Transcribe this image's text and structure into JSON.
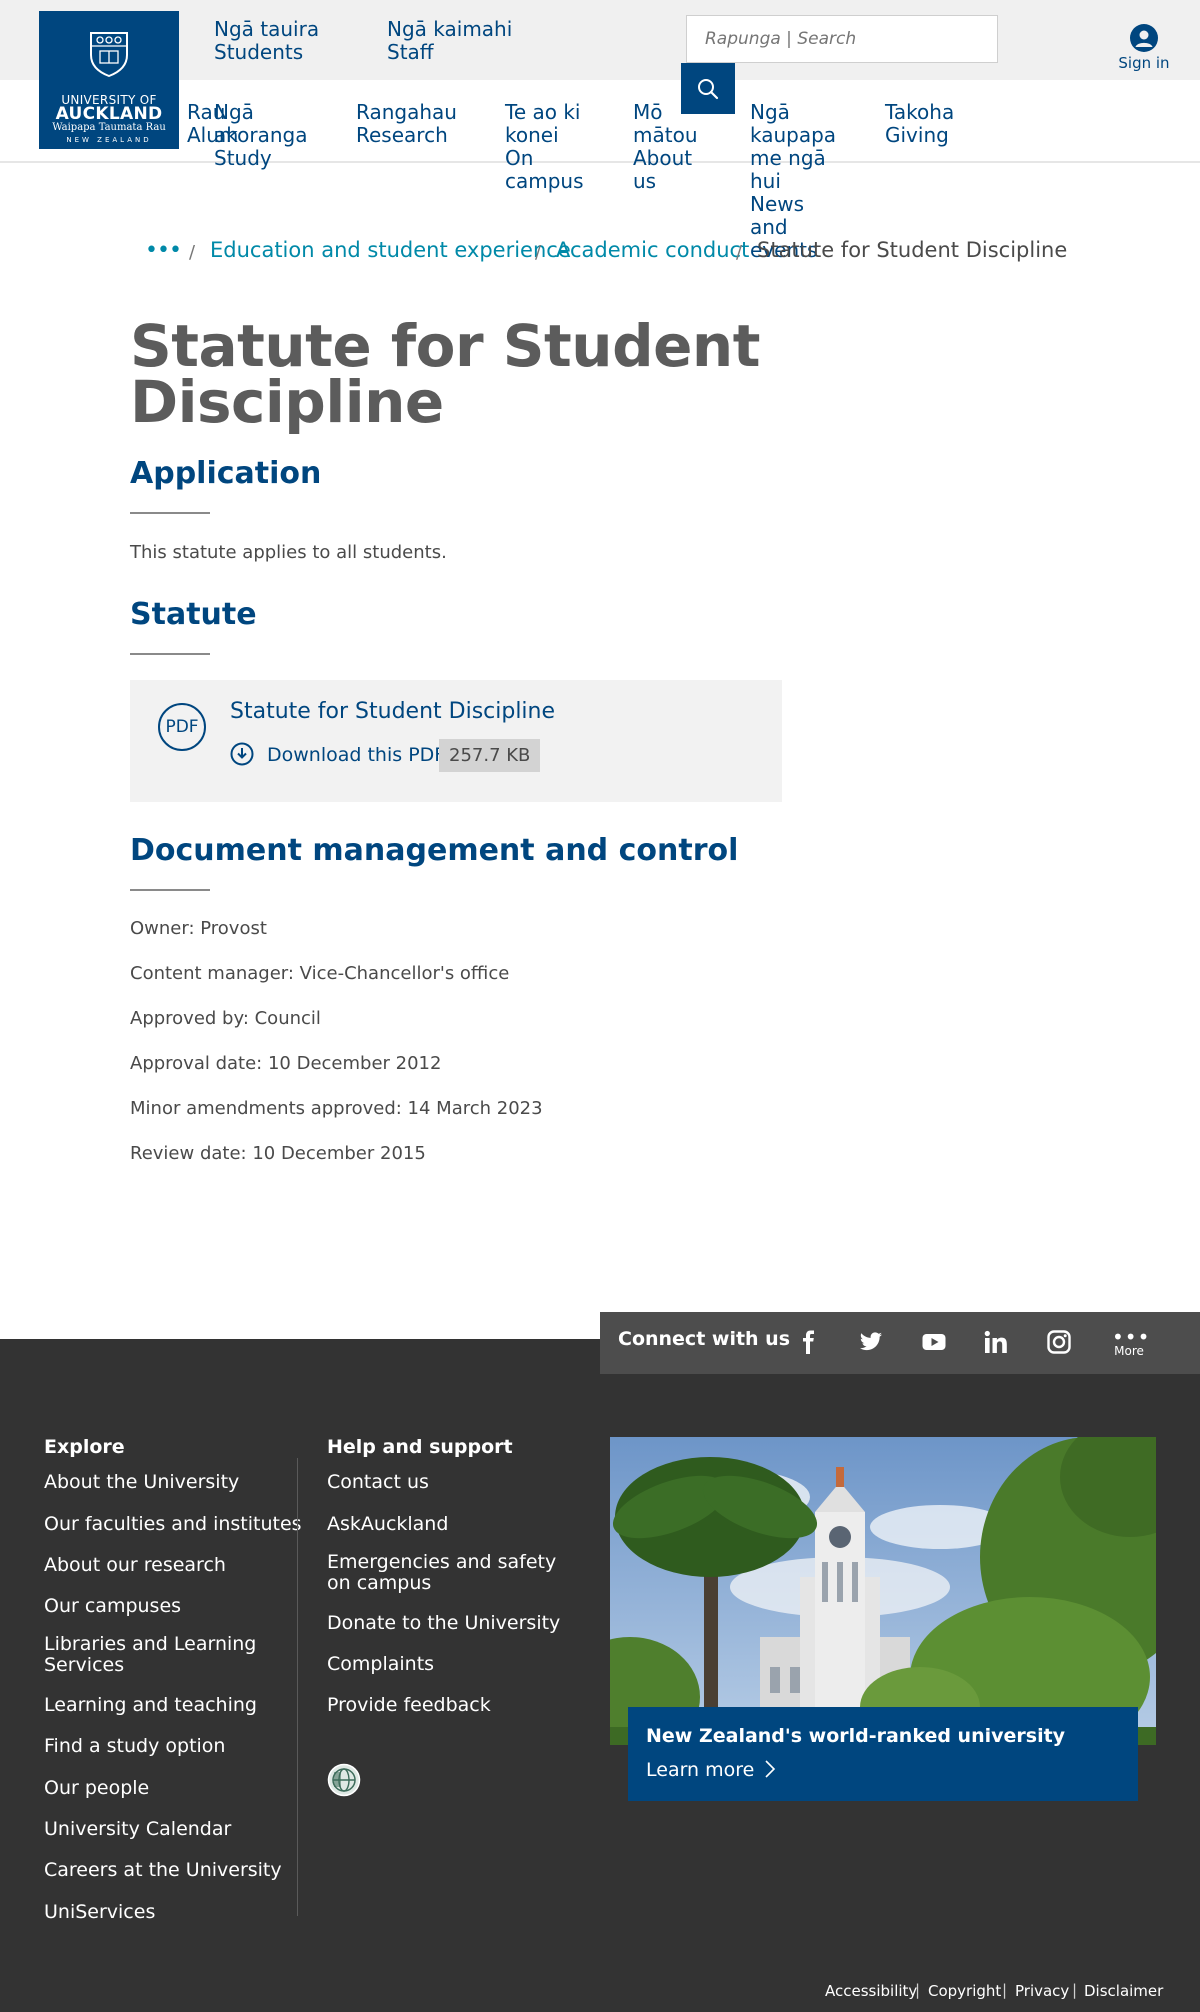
{
  "header": {
    "logo": {
      "line1": "UNIVERSITY OF",
      "line2": "AUCKLAND",
      "line3": "Waipapa Taumata Rau",
      "line4": "NEW ZEALAND"
    },
    "top_links": [
      {
        "maori": "Ngā tauira",
        "english": "Students"
      },
      {
        "maori": "Ngā kaimahi",
        "english": "Staff"
      }
    ],
    "search_placeholder": "Rapunga | Search",
    "sign_in": "Sign in",
    "nav": [
      {
        "line1": "Rau",
        "line1b": "Alum",
        "overlap1": "Ngā",
        "overlap2": "ni"
      },
      {
        "maori1": "akoranga",
        "english": "Study"
      },
      {
        "maori": "Rangahau",
        "english": "Research"
      },
      {
        "lines": [
          "Te ao ki",
          "konei",
          "On",
          "campus"
        ]
      },
      {
        "lines": [
          "Mō",
          "mātou",
          "About",
          "us"
        ]
      },
      {
        "lines": [
          "Ngā",
          "kaupapa",
          "me ngā",
          "hui",
          "News",
          "and",
          "events"
        ]
      },
      {
        "maori": "Takoha",
        "english": "Giving"
      }
    ]
  },
  "breadcrumb": {
    "ellipsis": "•••",
    "sep": "/",
    "items": [
      "Education and student experience",
      "Academic conduct"
    ],
    "current": "Statute for Student Discipline"
  },
  "page": {
    "title": "Statute for Student Discipline",
    "sections": {
      "application": {
        "heading": "Application",
        "text": "This statute applies to all students."
      },
      "statute": {
        "heading": "Statute",
        "pdf_badge": "PDF",
        "pdf_title": "Statute for Student Discipline",
        "download_label": "Download this PDF",
        "file_size": "257.7 KB"
      },
      "document": {
        "heading": "Document management and control",
        "items": [
          "Owner: Provost",
          "Content manager: Vice-Chancellor's office",
          "Approved by: Council",
          "Approval date: 10 December 2012",
          "Minor amendments approved: 14 March 2023",
          "Review date: 10 December 2015"
        ]
      }
    }
  },
  "footer": {
    "connect_label": "Connect with us",
    "social": [
      "facebook-icon",
      "twitter-icon",
      "youtube-icon",
      "linkedin-icon",
      "instagram-icon"
    ],
    "more_label": "More",
    "explore": {
      "heading": "Explore",
      "links": [
        "About the University",
        "Our faculties and institutes",
        "About our research",
        "Our campuses",
        "Libraries and Learning Services",
        "Learning and teaching",
        "Find a study option",
        "Our people",
        "University Calendar",
        "Careers at the University",
        "UniServices"
      ]
    },
    "help": {
      "heading": "Help and support",
      "links": [
        "Contact us",
        "AskAuckland",
        "Emergencies and safety on campus",
        "Donate to the University",
        "Complaints",
        "Provide feedback"
      ]
    },
    "promo": {
      "title": "New Zealand's world-ranked university",
      "link": "Learn more"
    },
    "legal": [
      "Accessibility",
      "Copyright",
      "Privacy",
      "Disclaimer"
    ],
    "legal_sep": "|"
  },
  "colors": {
    "brand_blue": "#00467f",
    "link_teal": "#0089a8",
    "footer_bg": "#333333",
    "connect_bg": "#4d4d4d"
  }
}
